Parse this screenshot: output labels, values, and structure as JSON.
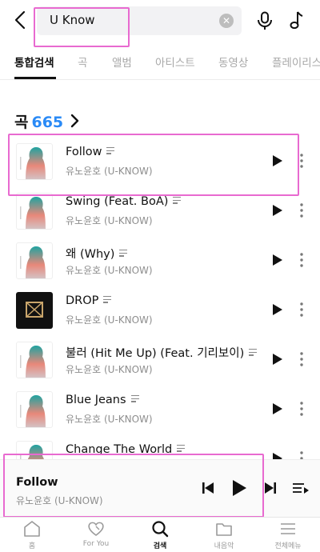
{
  "search": {
    "query": "U Know"
  },
  "tabs": [
    {
      "label": "통합검색",
      "active": true
    },
    {
      "label": "곡"
    },
    {
      "label": "앨범"
    },
    {
      "label": "아티스트"
    },
    {
      "label": "동영상"
    },
    {
      "label": "플레이리스트"
    }
  ],
  "section": {
    "label": "곡",
    "count": "665"
  },
  "songs": [
    {
      "title": "Follow",
      "artist": "유노윤호 (U-KNOW)",
      "art": "teal"
    },
    {
      "title": "Swing (Feat. BoA)",
      "artist": "유노윤호 (U-KNOW)",
      "art": "teal"
    },
    {
      "title": "왜 (Why)",
      "artist": "유노윤호 (U-KNOW)",
      "art": "teal"
    },
    {
      "title": "DROP",
      "artist": "유노윤호 (U-KNOW)",
      "art": "black"
    },
    {
      "title": "불러 (Hit Me Up) (Feat. 기리보이)",
      "artist": "유노윤호 (U-KNOW)",
      "art": "teal"
    },
    {
      "title": "Blue Jeans",
      "artist": "유노윤호 (U-KNOW)",
      "art": "teal"
    },
    {
      "title": "Change The World",
      "artist": "유노윤호 (U-KNOW)",
      "art": "teal"
    }
  ],
  "player": {
    "title": "Follow",
    "artist": "유노윤호 (U-KNOW)"
  },
  "nav": [
    {
      "label": "홈",
      "icon": "home-icon"
    },
    {
      "label": "For You",
      "icon": "heart-icon"
    },
    {
      "label": "검색",
      "icon": "search-icon",
      "active": true
    },
    {
      "label": "내음악",
      "icon": "folder-icon"
    },
    {
      "label": "전체메뉴",
      "icon": "menu-icon"
    }
  ],
  "colors": {
    "accent": "#2a8af6",
    "highlight": "#e86ad0"
  }
}
